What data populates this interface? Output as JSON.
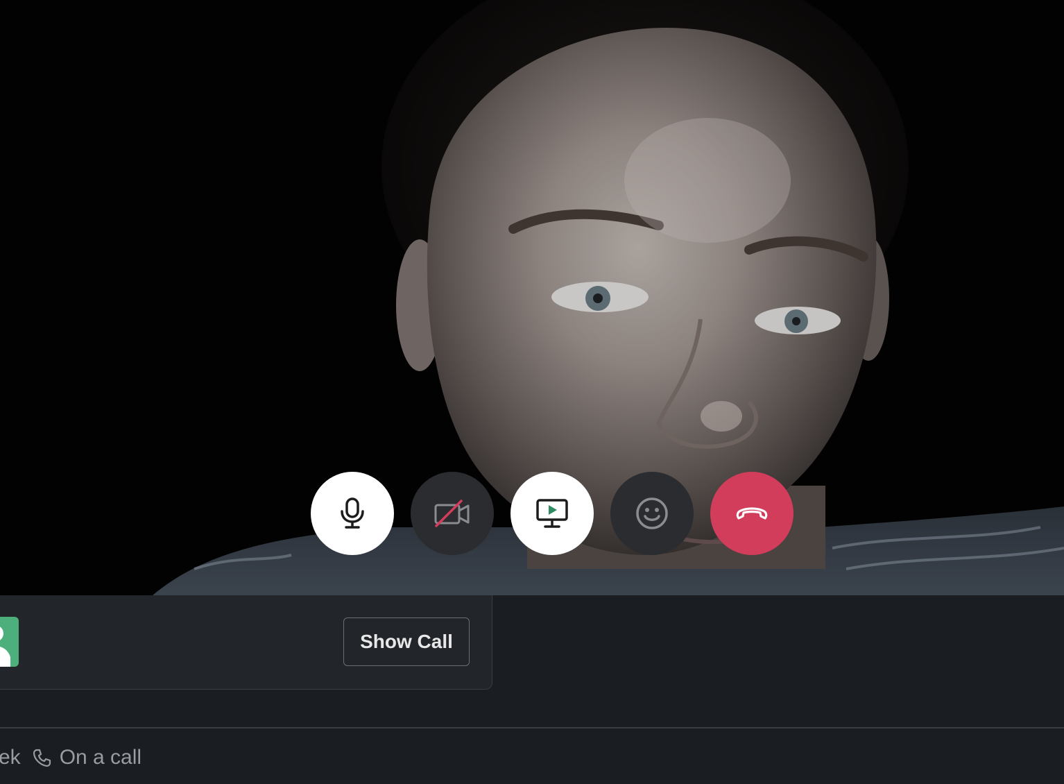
{
  "video": {
    "participant_feed": "camera-video"
  },
  "controls": {
    "buttons": [
      {
        "id": "microphone",
        "icon": "microphone-icon",
        "state": "on"
      },
      {
        "id": "camera",
        "icon": "camera-off-icon",
        "state": "off"
      },
      {
        "id": "screen_share",
        "icon": "screen-share-icon",
        "state": "available"
      },
      {
        "id": "reactions",
        "icon": "emoji-icon",
        "state": "available"
      },
      {
        "id": "leave_call",
        "icon": "hang-up-icon",
        "state": "available"
      }
    ]
  },
  "call_card": {
    "show_call_label": "Show Call"
  },
  "status_bar": {
    "prefix_text": "ek",
    "status_text": "On a call",
    "status_icon": "phone-icon"
  },
  "colors": {
    "hang_up_red": "#d23d5c",
    "avatar_green": "#4caf7c",
    "dark_control": "#2b2c2f",
    "panel_bg": "#1a1d21",
    "card_bg": "#222529",
    "camera_off_slash": "#d23d5c",
    "screen_share_play": "#2e8b62"
  }
}
